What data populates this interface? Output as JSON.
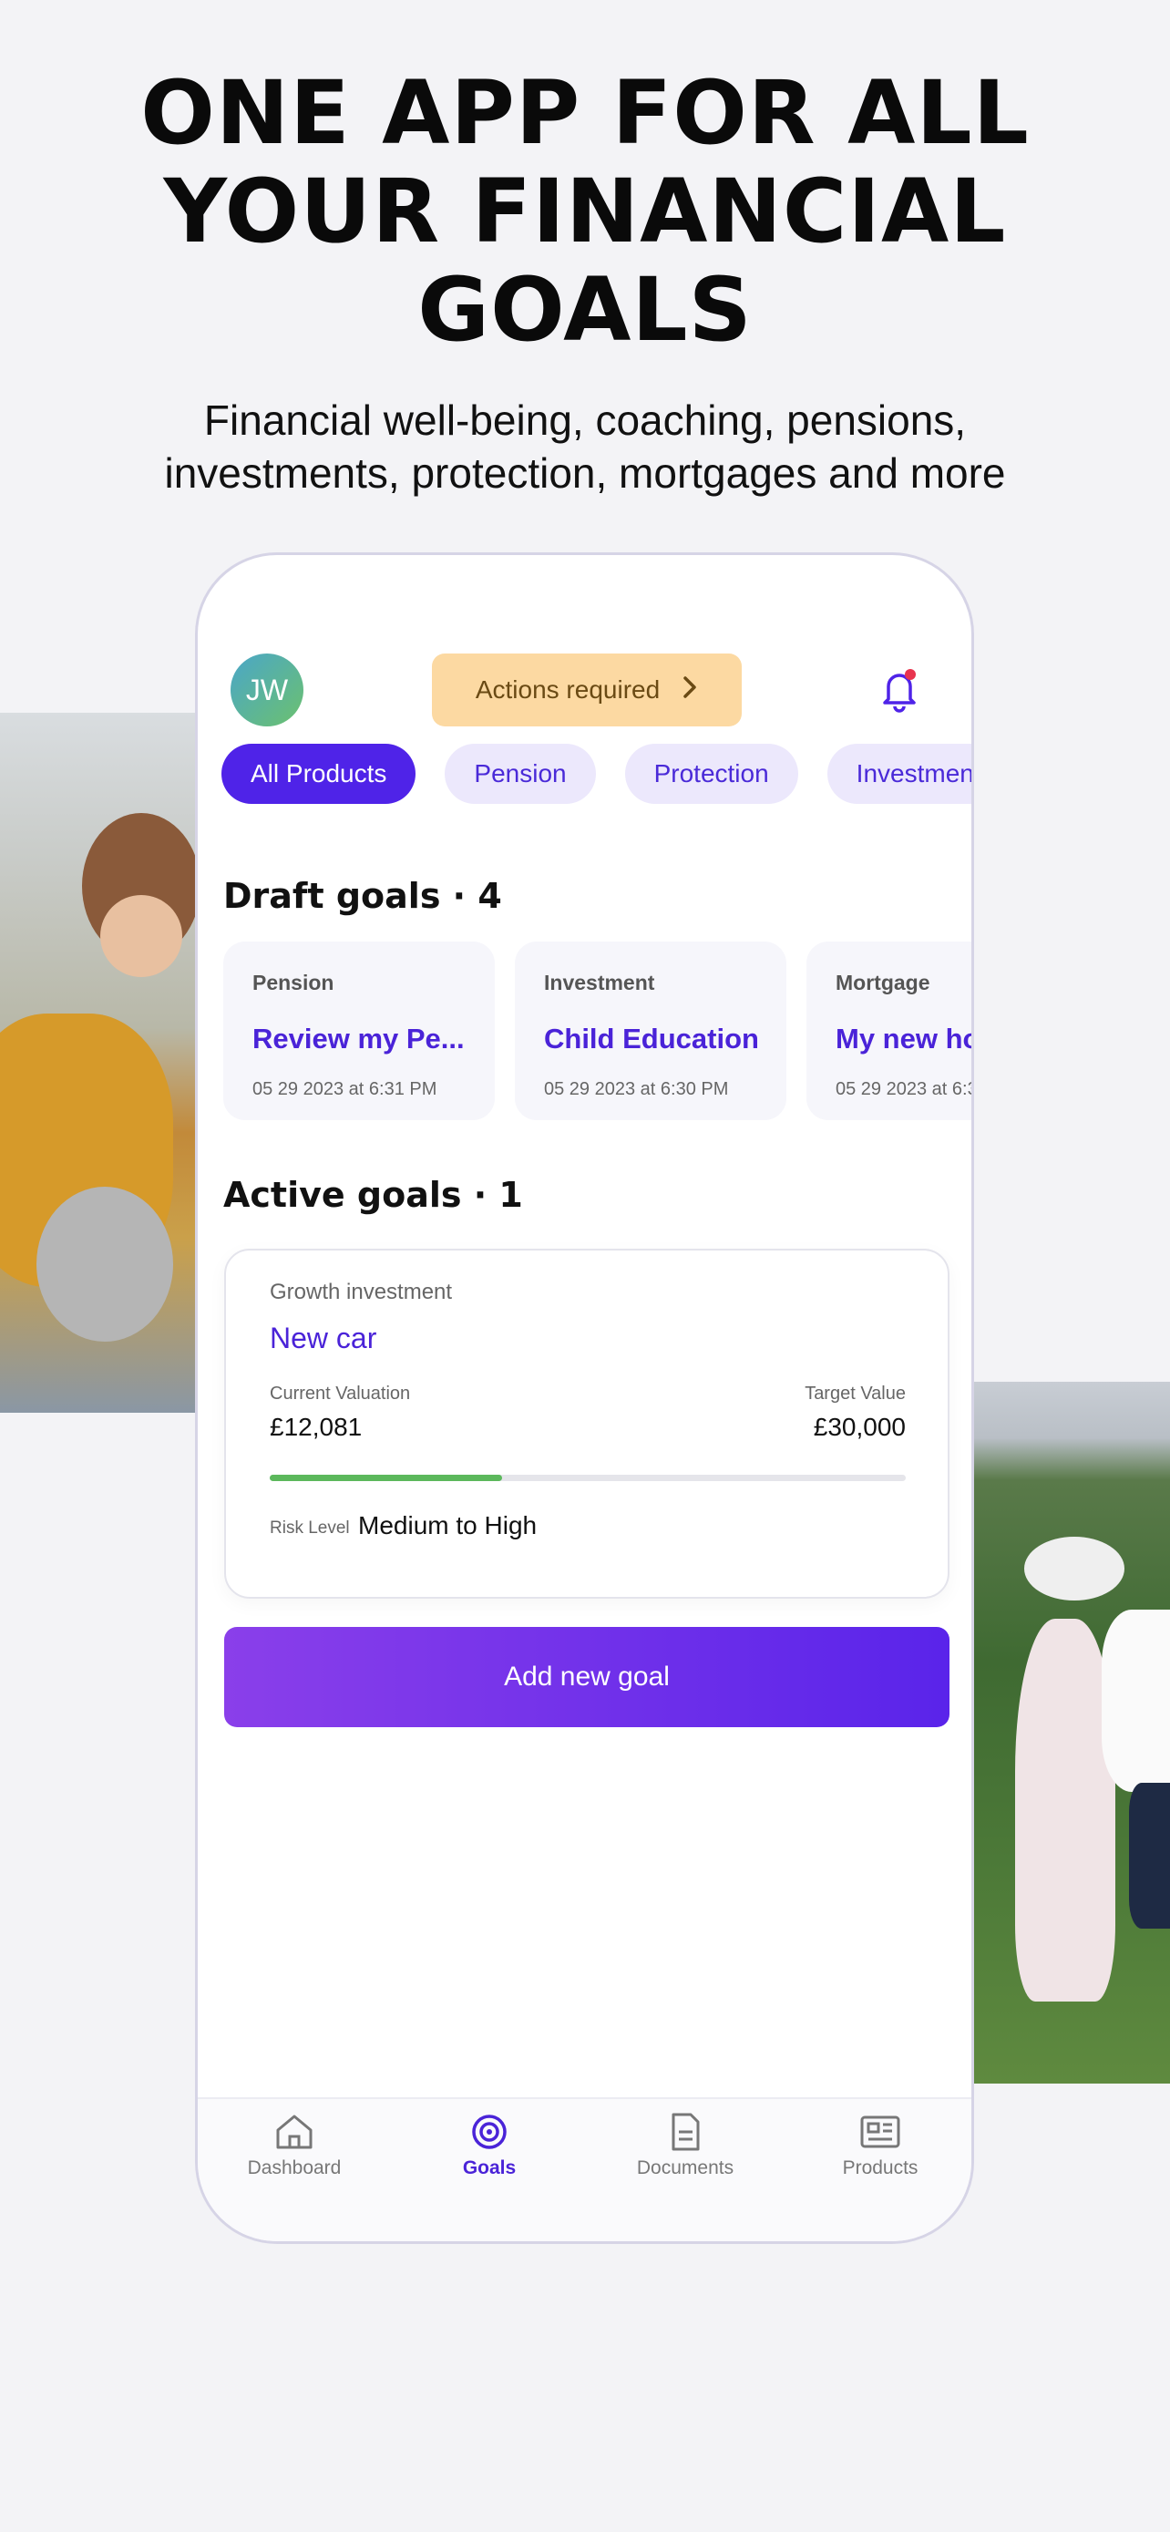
{
  "headline": [
    "ONE APP FOR ALL",
    "YOUR FINANCIAL",
    "GOALS"
  ],
  "subhead": [
    "Financial well-being, coaching, pensions,",
    "investments, protection, mortgages and more"
  ],
  "header": {
    "avatar_initials": "JW",
    "actions_label": "Actions required",
    "bell_icon": "bell-icon"
  },
  "filters": [
    "All Products",
    "Pension",
    "Protection",
    "Investmen"
  ],
  "drafts": {
    "title": "Draft goals · 4",
    "items": [
      {
        "category": "Pension",
        "name": "Review my Pe...",
        "date": "05 29 2023 at 6:31 PM"
      },
      {
        "category": "Investment",
        "name": "Child Education",
        "date": "05 29 2023 at 6:30 PM"
      },
      {
        "category": "Mortgage",
        "name": "My new ho",
        "date": "05 29 2023 at 6:3"
      }
    ]
  },
  "active": {
    "title": "Active goals · 1",
    "goal": {
      "type": "Growth investment",
      "name": "New car",
      "current_label": "Current Valuation",
      "current_value": "£12,081",
      "target_label": "Target Value",
      "target_value": "£30,000",
      "progress_fraction": 0.366,
      "risk_label": "Risk Level",
      "risk_value": "Medium to High"
    }
  },
  "add_goal_label": "Add new goal",
  "tabs": [
    {
      "label": "Dashboard",
      "icon": "home-icon"
    },
    {
      "label": "Goals",
      "icon": "target-icon"
    },
    {
      "label": "Documents",
      "icon": "document-icon"
    },
    {
      "label": "Products",
      "icon": "newspaper-icon"
    }
  ],
  "colors": {
    "accent": "#4f23e8",
    "progress": "#5cb85c",
    "actions_bg": "#fcd9a2"
  }
}
